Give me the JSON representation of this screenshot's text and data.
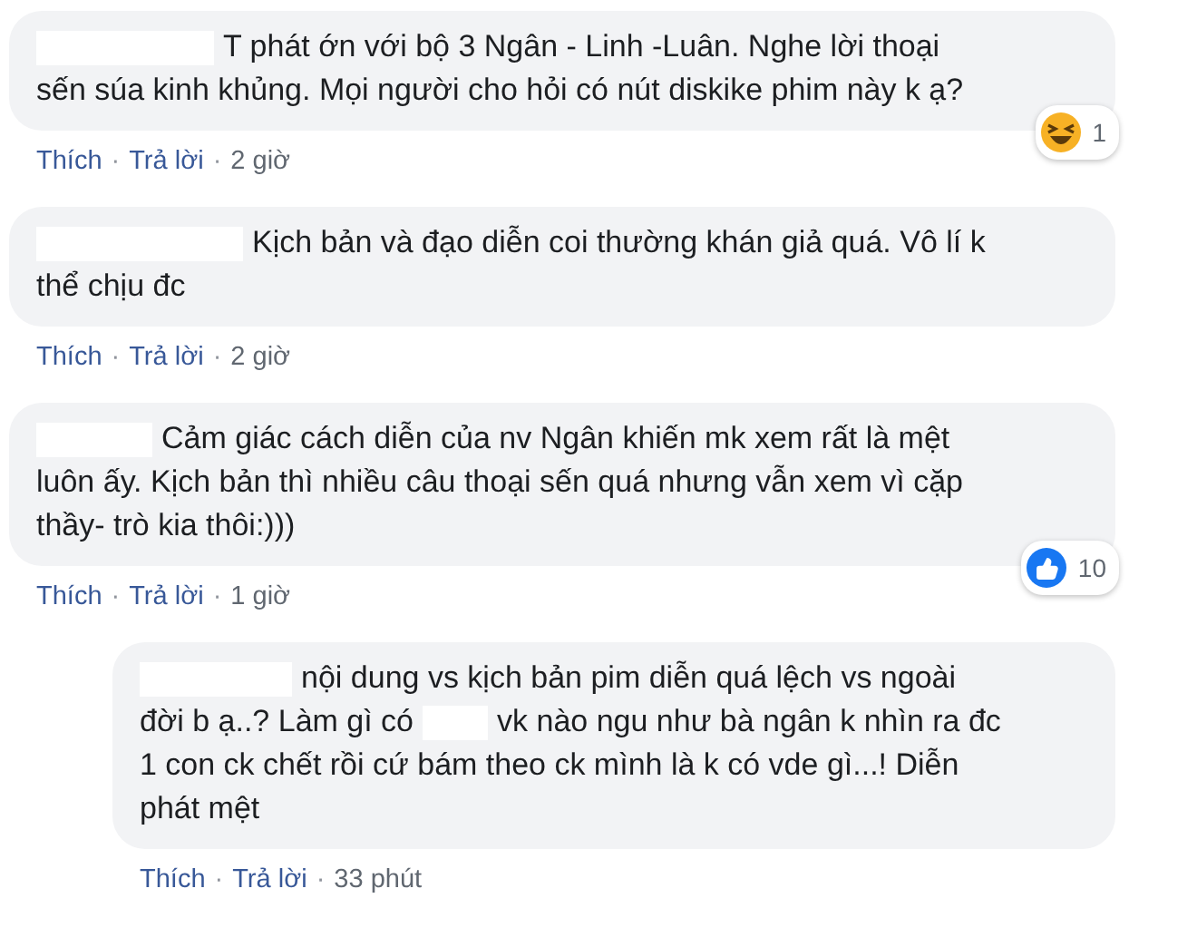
{
  "comments": [
    {
      "reply": false,
      "lines": [
        [
          {
            "kind": "redaction"
          },
          {
            "kind": "text",
            "text": "T phát ớn với bộ 3 Ngân - Linh -Luân. Nghe lời thoại"
          }
        ],
        [
          {
            "kind": "text",
            "text": "sến súa kinh khủng. Mọi người cho hỏi có nút diskike phim này k ạ?"
          }
        ]
      ],
      "actions": [
        {
          "kind": "link",
          "text": "Thích"
        },
        {
          "kind": "dot",
          "text": "·"
        },
        {
          "kind": "link",
          "text": "Trả lời"
        },
        {
          "kind": "dot",
          "text": "·"
        },
        {
          "kind": "time",
          "text": "2 giờ"
        }
      ],
      "reaction": {
        "kind": "haha",
        "count": "1"
      }
    },
    {
      "reply": false,
      "lines": [
        [
          {
            "kind": "redaction"
          },
          {
            "kind": "text",
            "text": "Kịch bản và đạo diễn coi thường khán giả quá. Vô lí k"
          }
        ],
        [
          {
            "kind": "text",
            "text": "thể chịu đc"
          }
        ]
      ],
      "actions": [
        {
          "kind": "link",
          "text": "Thích"
        },
        {
          "kind": "dot",
          "text": "·"
        },
        {
          "kind": "link",
          "text": "Trả lời"
        },
        {
          "kind": "dot",
          "text": "·"
        },
        {
          "kind": "time",
          "text": "2 giờ"
        }
      ]
    },
    {
      "reply": false,
      "lines": [
        [
          {
            "kind": "redaction"
          },
          {
            "kind": "text",
            "text": "Cảm giác cách diễn của nv Ngân khiến mk xem rất là mệt"
          }
        ],
        [
          {
            "kind": "text",
            "text": "luôn ấy. Kịch bản thì nhiều câu thoại sến quá nhưng vẫn xem vì cặp"
          }
        ],
        [
          {
            "kind": "text",
            "text": "thầy- trò kia thôi:)))"
          }
        ]
      ],
      "actions": [
        {
          "kind": "link",
          "text": "Thích"
        },
        {
          "kind": "dot",
          "text": "·"
        },
        {
          "kind": "link",
          "text": "Trả lời"
        },
        {
          "kind": "dot",
          "text": "·"
        },
        {
          "kind": "time",
          "text": "1 giờ"
        }
      ],
      "reaction": {
        "kind": "like",
        "count": "10"
      }
    },
    {
      "reply": true,
      "lines": [
        [
          {
            "kind": "redaction"
          },
          {
            "kind": "text",
            "text": "nội dung vs kịch bản pim diễn quá lệch vs ngoài"
          }
        ],
        [
          {
            "kind": "text",
            "text": "đời b ạ..? Làm gì có"
          },
          {
            "kind": "redaction"
          },
          {
            "kind": "text",
            "text": "vk nào ngu như bà ngân k nhìn ra đc"
          }
        ],
        [
          {
            "kind": "text",
            "text": "1 con ck chết rồi cứ bám theo ck mình là k có vde gì...! Diễn"
          }
        ],
        [
          {
            "kind": "text",
            "text": "phát mệt"
          }
        ]
      ],
      "actions": [
        {
          "kind": "link",
          "text": "Thích"
        },
        {
          "kind": "dot",
          "text": "·"
        },
        {
          "kind": "link",
          "text": "Trả lời"
        },
        {
          "kind": "dot",
          "text": "·"
        },
        {
          "kind": "time",
          "text": "33 phút"
        }
      ]
    }
  ]
}
